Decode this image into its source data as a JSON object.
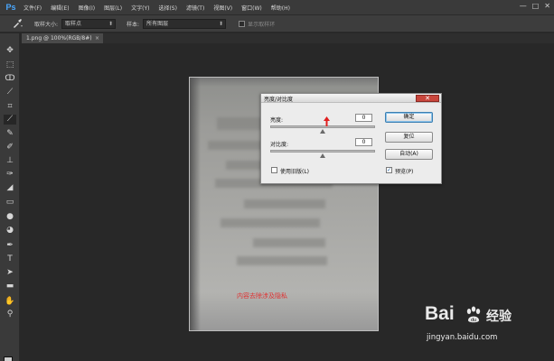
{
  "app": {
    "logo": "Ps"
  },
  "menu": [
    "文件(F)",
    "编辑(E)",
    "图像(I)",
    "图层(L)",
    "文字(Y)",
    "选择(S)",
    "滤镜(T)",
    "视图(V)",
    "窗口(W)",
    "帮助(H)"
  ],
  "window_controls": [
    "—",
    "□",
    "✕"
  ],
  "options": {
    "sample_size_label": "取样大小:",
    "sample_size_value": "取样点",
    "sample_label": "样本:",
    "sample_value": "所有图层",
    "show_ring_label": "显示取样环"
  },
  "tab": {
    "label": "1.png @ 100%(RGB/8#)",
    "close": "×"
  },
  "toolbar": {
    "tools": [
      "move-tool",
      "marquee-tool",
      "lasso-tool",
      "quick-select-tool",
      "crop-tool",
      "eyedropper-tool",
      "healing-brush-tool",
      "brush-tool",
      "clone-stamp-tool",
      "history-brush-tool",
      "eraser-tool",
      "gradient-tool",
      "blur-tool",
      "dodge-tool",
      "pen-tool",
      "type-tool",
      "path-select-tool",
      "rectangle-tool",
      "hand-tool",
      "zoom-tool"
    ],
    "active_tool": "eyedropper-tool"
  },
  "document": {
    "overlay_text": "内容去除涉及隐私"
  },
  "dialog": {
    "title": "亮度/对比度",
    "close": "✕",
    "brightness_label": "亮度:",
    "brightness_value": "0",
    "brightness_level": 0.5,
    "contrast_label": "对比度:",
    "contrast_value": "0",
    "contrast_level": 0.5,
    "legacy_label": "使用旧版(L)",
    "legacy_checked": false,
    "preview_label": "预览(P)",
    "preview_checked": true,
    "ok_label": "确定",
    "reset_label": "复位",
    "auto_label": "自动(A)"
  },
  "watermark": {
    "brand": "Bai",
    "brand_cn": "经验",
    "url": "jingyan.baidu.com"
  },
  "colors": {
    "menubar": "#3a3a3a",
    "canvas": "#282828",
    "dialog": "#ececec",
    "accent_red": "#e03030",
    "close_red": "#c9463c"
  }
}
